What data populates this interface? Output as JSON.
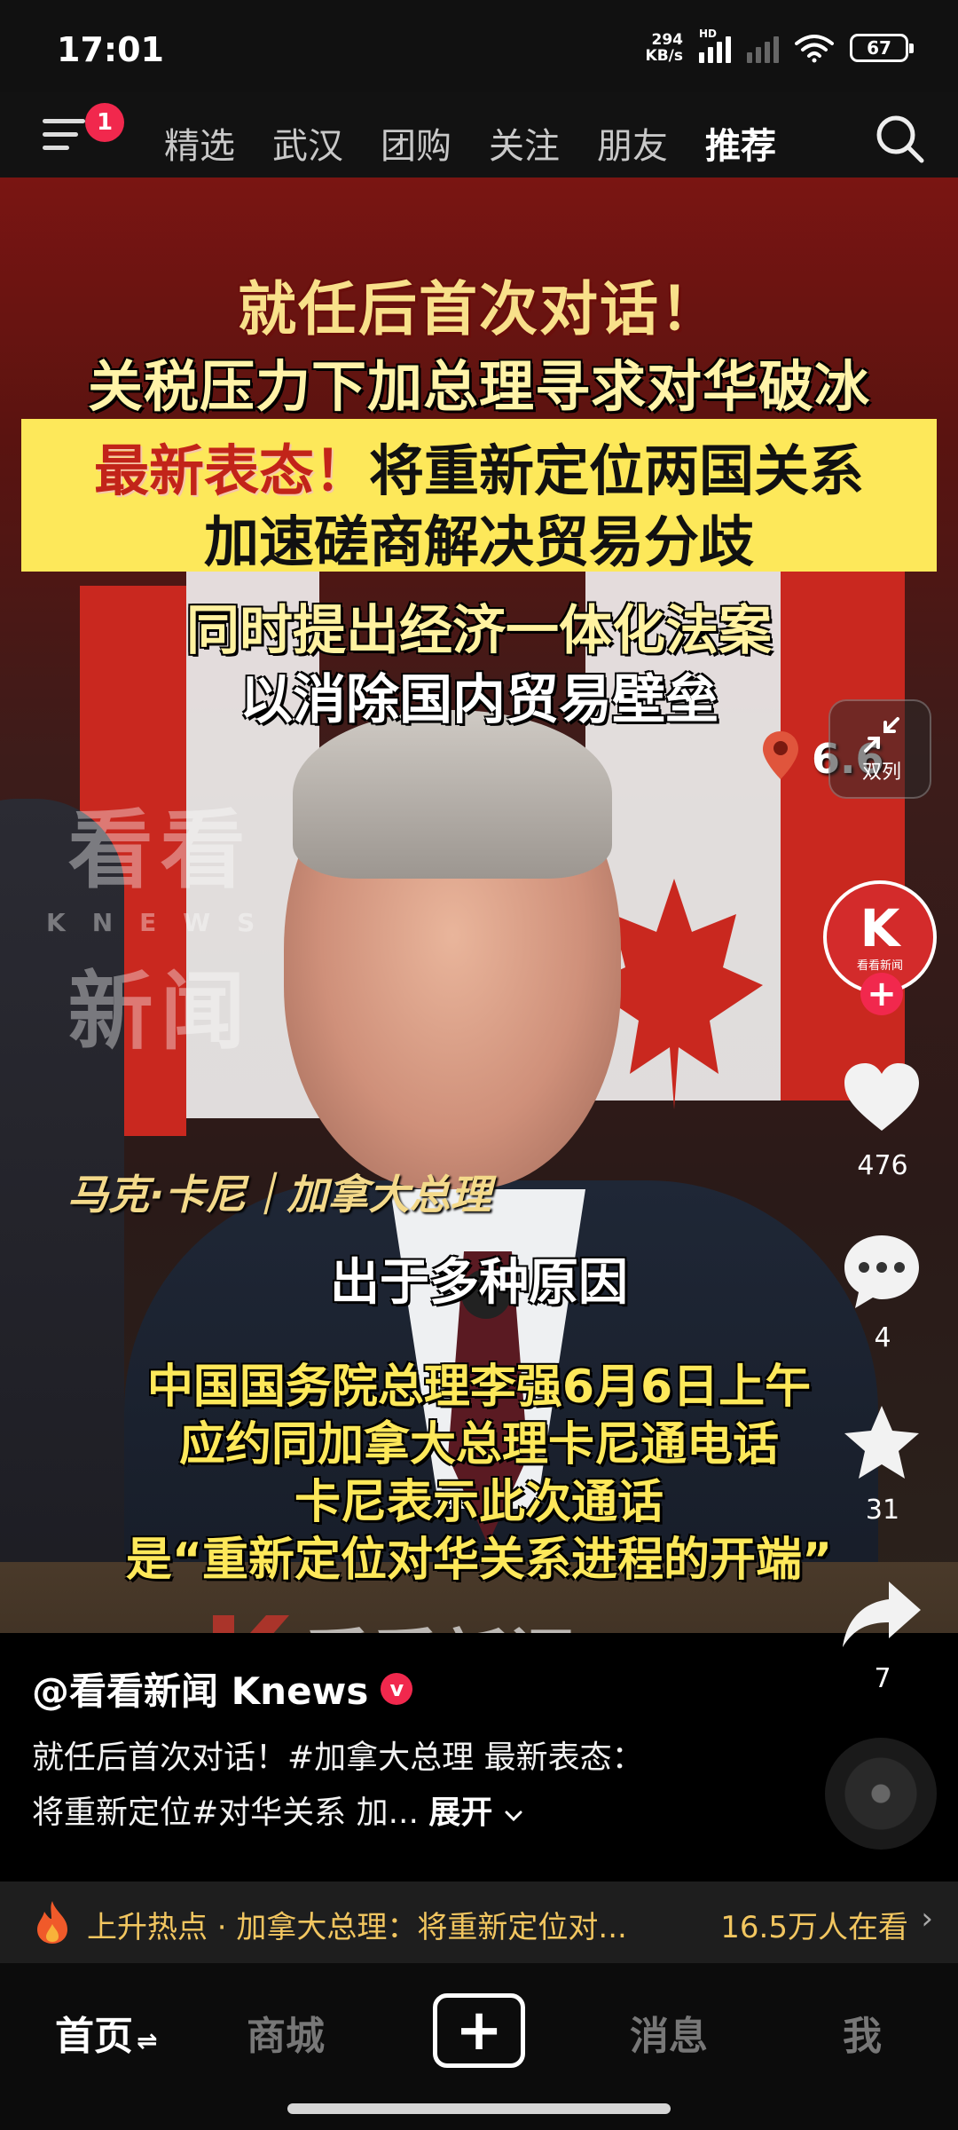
{
  "status_bar": {
    "time": "17:01",
    "net_speed_value": "294",
    "net_speed_unit": "KB/s",
    "hd_label": "HD",
    "battery": "67"
  },
  "top_nav": {
    "notification_count": "1",
    "tabs": [
      {
        "label": "精选"
      },
      {
        "label": "武汉"
      },
      {
        "label": "团购"
      },
      {
        "label": "关注"
      },
      {
        "label": "朋友"
      },
      {
        "label": "推荐",
        "active": true
      }
    ]
  },
  "video": {
    "headline_1": "就任后首次对话！",
    "headline_2": "关税压力下加总理寻求对华破冰",
    "banner_red": "最新表态！",
    "banner_black": "将重新定位两国关系",
    "banner_line2": "加速磋商解决贸易分歧",
    "headline_3": "同时提出经济一体化法案",
    "headline_4": "以消除国内贸易壁垒",
    "watermark_cn_1": "看看",
    "watermark_en": "KNEWS",
    "watermark_cn_2": "新闻",
    "location_text": "6.6",
    "shrink_label": "双列",
    "name_caption": "马克·卡尼｜加拿大总理",
    "subtitle_white": "出于多种原因",
    "subtitle_yellow": [
      "中国国务院总理李强6月6日上午",
      "应约同加拿大总理卡尼通电话",
      "卡尼表示此次通话",
      "是“重新定位对华关系进程的开端”"
    ],
    "bottom_logo_text": "看看新闻Knews"
  },
  "actions": {
    "avatar_initial": "K",
    "avatar_caption": "看看新闻",
    "follow_symbol": "+",
    "likes": "476",
    "comments": "4",
    "favorites": "31",
    "shares": "7"
  },
  "info": {
    "author": "@看看新闻 Knews",
    "verified_symbol": "v",
    "description": "就任后首次对话！#加拿大总理 最新表态：将重新定位#对华关系 加...",
    "expand_label": "展开"
  },
  "hot_bar": {
    "text": "上升热点 · 加拿大总理：将重新定位对...",
    "count": "16.5万人在看",
    "chevron": "›"
  },
  "bottom_nav": {
    "home": "首页",
    "mall": "商城",
    "add": "+",
    "messages": "消息",
    "me": "我",
    "switch_glyph": "⇌"
  },
  "colors": {
    "accent_red": "#f1284d",
    "caption_yellow": "#fde85a",
    "hot_gold": "#f2c660"
  }
}
